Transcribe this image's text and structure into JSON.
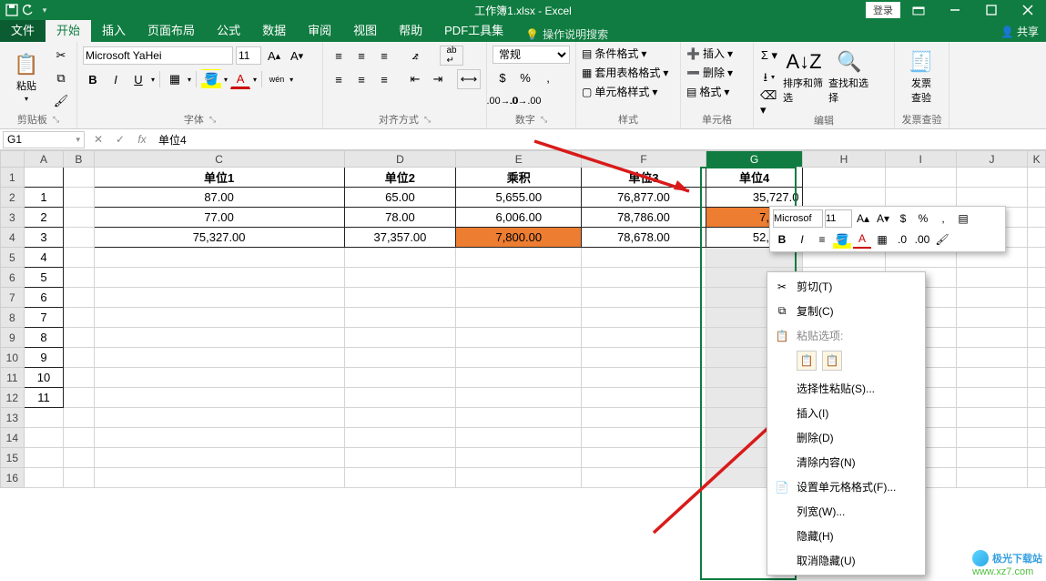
{
  "titlebar": {
    "title": "工作簿1.xlsx  -  Excel",
    "login": "登录"
  },
  "tabs": {
    "file": "文件",
    "home": "开始",
    "insert": "插入",
    "layout": "页面布局",
    "formula": "公式",
    "data": "数据",
    "review": "审阅",
    "view": "视图",
    "help": "帮助",
    "pdf": "PDF工具集",
    "tellme": "操作说明搜索",
    "share": "共享"
  },
  "ribbon": {
    "clipboard": {
      "paste": "粘贴",
      "label": "剪贴板"
    },
    "font": {
      "name": "Microsoft YaHei",
      "size": "11",
      "label": "字体",
      "wen": "wén"
    },
    "align": {
      "label": "对齐方式"
    },
    "number": {
      "format": "常规",
      "label": "数字"
    },
    "styles": {
      "condfmt": "条件格式",
      "tablefmt": "套用表格格式",
      "cellstyle": "单元格样式",
      "label": "样式"
    },
    "cells": {
      "insert": "插入",
      "delete": "删除",
      "format": "格式",
      "label": "单元格"
    },
    "editing": {
      "sortfilter": "排序和筛选",
      "findselect": "查找和选择",
      "label": "编辑"
    },
    "invoice": {
      "btn": "发票\n查验",
      "label": "发票查验"
    }
  },
  "fxbar": {
    "ref": "G1",
    "value": "单位4"
  },
  "columns": [
    "A",
    "B",
    "C",
    "D",
    "E",
    "F",
    "G",
    "H",
    "I",
    "J",
    "K"
  ],
  "rows": [
    "1",
    "2",
    "3",
    "4",
    "5",
    "6",
    "7",
    "8",
    "9",
    "10",
    "11",
    "12",
    "13",
    "14",
    "15",
    "16"
  ],
  "data": {
    "a": [
      "",
      "1",
      "2",
      "3",
      "4",
      "5",
      "6",
      "7",
      "8",
      "9",
      "10",
      "11"
    ],
    "headers": {
      "c": "单位1",
      "d": "单位2",
      "e": "乘积",
      "f": "单位3",
      "g": "单位4"
    },
    "r2": {
      "c": "87.00",
      "d": "65.00",
      "e": "5,655.00",
      "f": "76,877.00",
      "g": "35,727.0"
    },
    "r3": {
      "c": "77.00",
      "d": "78.00",
      "e": "6,006.00",
      "f": "78,786.00",
      "g": "7,800.0"
    },
    "r4": {
      "c": "75,327.00",
      "d": "37,357.00",
      "e": "7,800.00",
      "f": "78,678.00",
      "g": "52,745.0"
    }
  },
  "mini": {
    "font": "Microsof",
    "size": "11"
  },
  "ctx": {
    "cut": "剪切(T)",
    "copy": "复制(C)",
    "pasteopts": "粘贴选项:",
    "pastespecial": "选择性粘贴(S)...",
    "insert": "插入(I)",
    "delete": "删除(D)",
    "clear": "清除内容(N)",
    "format": "设置单元格格式(F)...",
    "colwidth": "列宽(W)...",
    "hide": "隐藏(H)",
    "unhide": "取消隐藏(U)"
  },
  "watermark": {
    "line1": "极光下载站",
    "line2": "www.xz7.com"
  }
}
